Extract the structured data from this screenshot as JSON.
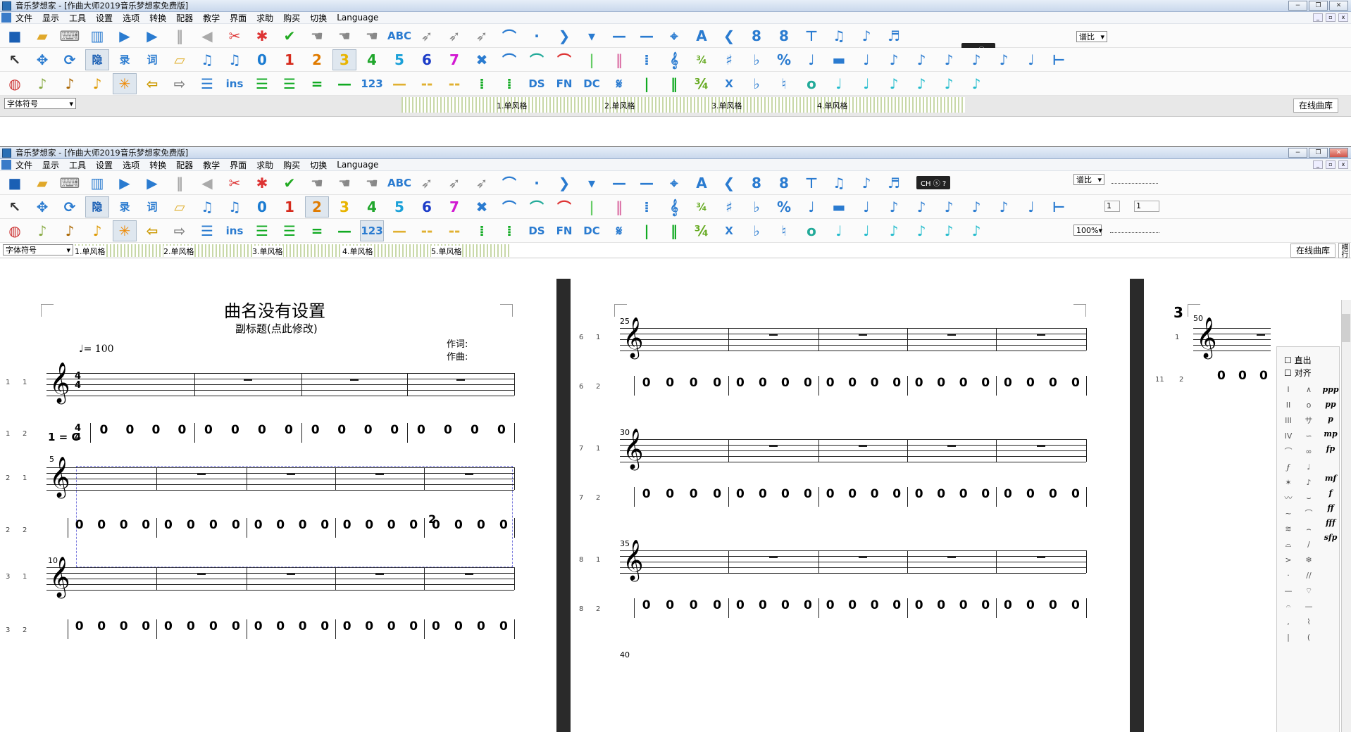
{
  "app_title": "音乐梦想家 - [作曲大师2019音乐梦想家免费版]",
  "menu": [
    "文件",
    "显示",
    "工具",
    "设置",
    "选项",
    "转换",
    "配器",
    "教学",
    "界面",
    "求助",
    "购买",
    "切换",
    "Language"
  ],
  "window_buttons": [
    "−",
    "❐",
    "✕"
  ],
  "toggle_label": "CH",
  "controls": {
    "spectrum_label": "谱比",
    "zoom": "100%",
    "field1": "1",
    "field2": "1",
    "font_symbol": "字体符号",
    "online_library": "在线曲库",
    "vertical_tab": "横行",
    "online_library_banner": "在线曲库"
  },
  "toolbar_row2_numbers": [
    "0",
    "1",
    "2",
    "3",
    "4",
    "5",
    "6",
    "7"
  ],
  "toolbar_row2_numbers_colors": [
    "#1a7bd1",
    "#d62a1c",
    "#e07b00",
    "#e8b400",
    "#1fa62b",
    "#1aa0d8",
    "#1c3cc8",
    "#d21ad2"
  ],
  "toolbar_row3_labels": {
    "ins": "ins",
    "n123": "123",
    "ds": "DS",
    "fn": "FN",
    "dc": "DC",
    "x": "X"
  },
  "tracks": [
    "1.单风格",
    "2.单风格",
    "3.单风格",
    "4.单风格",
    "5.单风格"
  ],
  "score": {
    "title": "曲名没有设置",
    "subtitle": "副标题(点此修改)",
    "lyricist": "作词:",
    "composer": "作曲:",
    "tempo": "= 100",
    "key": "1 = C",
    "time_top": "4",
    "time_bottom": "4",
    "zero": "0",
    "measure_numbers": {
      "m5": "5",
      "m10": "10",
      "m25": "25",
      "m30": "30",
      "m35": "35",
      "m40": "40",
      "m50": "50"
    },
    "row_labels_left": [
      [
        "1",
        "1"
      ],
      [
        "1",
        "2"
      ],
      [
        "2",
        "1"
      ],
      [
        "2",
        "2"
      ],
      [
        "3",
        "1"
      ],
      [
        "3",
        "2"
      ]
    ],
    "row_labels_mid": [
      [
        "6",
        "1"
      ],
      [
        "6",
        "2"
      ],
      [
        "7",
        "1"
      ],
      [
        "7",
        "2"
      ],
      [
        "8",
        "1"
      ],
      [
        "8",
        "2"
      ]
    ],
    "row_labels_right": [
      [
        "1"
      ],
      [
        "11",
        "2"
      ]
    ],
    "marker_3": "3",
    "marker_2": "2"
  },
  "palette": {
    "straight_out": "直出",
    "align": "对齐",
    "dynamics": [
      "ppp",
      "pp",
      "p",
      "mp",
      "fp",
      "mf",
      "f",
      "ff",
      "fff",
      "sfp"
    ]
  }
}
